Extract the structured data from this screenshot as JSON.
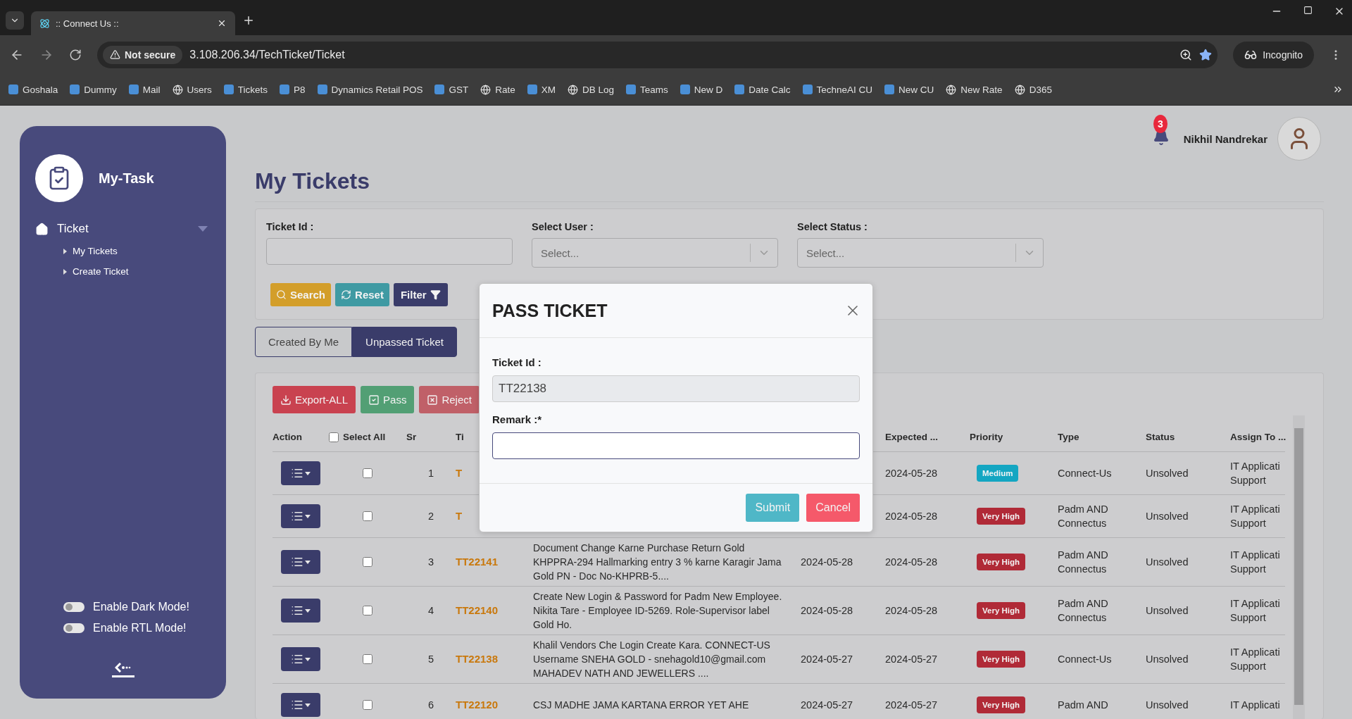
{
  "browser": {
    "tab_title": ":: Connect Us ::",
    "security": "Not secure",
    "url": "3.108.206.34/TechTicket/Ticket",
    "profile": "Incognito",
    "bookmarks": [
      {
        "label": "Goshala",
        "kind": "favicon"
      },
      {
        "label": "Dummy",
        "kind": "favicon"
      },
      {
        "label": "Mail",
        "kind": "favicon"
      },
      {
        "label": "Users",
        "kind": "globe"
      },
      {
        "label": "Tickets",
        "kind": "favicon"
      },
      {
        "label": "P8",
        "kind": "favicon"
      },
      {
        "label": "Dynamics Retail POS",
        "kind": "favicon"
      },
      {
        "label": "GST",
        "kind": "favicon"
      },
      {
        "label": "Rate",
        "kind": "globe"
      },
      {
        "label": "XM",
        "kind": "favicon"
      },
      {
        "label": "DB Log",
        "kind": "globe"
      },
      {
        "label": "Teams",
        "kind": "favicon"
      },
      {
        "label": "New D",
        "kind": "favicon"
      },
      {
        "label": "Date Calc",
        "kind": "favicon"
      },
      {
        "label": "TechneAI CU",
        "kind": "favicon"
      },
      {
        "label": "New CU",
        "kind": "favicon"
      },
      {
        "label": "New Rate",
        "kind": "globe"
      },
      {
        "label": "D365",
        "kind": "globe"
      }
    ]
  },
  "sidebar": {
    "app_name": "My-Task",
    "menu": [
      {
        "label": "Ticket",
        "expanded": true,
        "children": [
          {
            "label": "My Tickets"
          },
          {
            "label": "Create Ticket"
          }
        ]
      }
    ],
    "toggles": [
      {
        "label": "Enable Dark Mode!",
        "on": false
      },
      {
        "label": "Enable RTL Mode!",
        "on": false
      }
    ]
  },
  "header": {
    "notification_count": "3",
    "user_name": "Nikhil Nandrekar"
  },
  "page_title": "My Tickets",
  "filters": [
    {
      "label": "Ticket Id :",
      "kind": "text"
    },
    {
      "label": "Select User :",
      "kind": "select",
      "placeholder": "Select..."
    },
    {
      "label": "Select Status :",
      "kind": "select",
      "placeholder": "Select..."
    }
  ],
  "filter_buttons": [
    {
      "label": "Search",
      "kind": "search"
    },
    {
      "label": "Reset",
      "kind": "reset"
    },
    {
      "label": "Filter",
      "kind": "filter"
    }
  ],
  "tabs": [
    {
      "label": "Created By Me",
      "selected": false
    },
    {
      "label": "Unpassed Ticket",
      "selected": true
    }
  ],
  "actions": [
    {
      "label": "Export-ALL",
      "kind": "export"
    },
    {
      "label": "Pass",
      "kind": "pass"
    },
    {
      "label": "Reject",
      "kind": "reject"
    }
  ],
  "table": {
    "select_all": {
      "label": "Select All",
      "checked": false
    },
    "columns": {
      "action": "Action",
      "sr": "Sr",
      "ticket_id": "Ti",
      "expected": "Expected ...",
      "priority": "Priority",
      "type": "Type",
      "status": "Status",
      "assign_to": "Assign To ..."
    },
    "rows": [
      {
        "checked": false,
        "sr": "1",
        "ticket_id": "T",
        "expected": "2024-05-28",
        "priority": {
          "label": "Medium",
          "color": "#14a6c2"
        },
        "type": "Connect-Us",
        "status": "Unsolved",
        "assign_to": "IT Applicati Support"
      },
      {
        "checked": false,
        "sr": "2",
        "ticket_id": "T",
        "expected": "2024-05-28",
        "priority": {
          "label": "Very High",
          "color": "#b02a37"
        },
        "type": "Padm AND Connectus",
        "status": "Unsolved",
        "assign_to": "IT Applicati Support"
      },
      {
        "checked": false,
        "sr": "3",
        "ticket_id": "TT22141",
        "description": "Document Change Karne Purchase Return Gold KHPPRA-294 Hallmarking entry 3 % karne Karagir Jama Gold PN - Doc No-KHPRB-5....",
        "created": "2024-05-28",
        "expected": "2024-05-28",
        "priority": {
          "label": "Very High",
          "color": "#b02a37"
        },
        "type": "Padm AND Connectus",
        "status": "Unsolved",
        "assign_to": "IT Applicati Support"
      },
      {
        "checked": false,
        "sr": "4",
        "ticket_id": "TT22140",
        "description": "Create New Login & Password for Padm New Employee. Nikita Tare - Employee ID-5269. Role-Supervisor label Gold Ho.",
        "created": "2024-05-28",
        "expected": "2024-05-28",
        "priority": {
          "label": "Very High",
          "color": "#b02a37"
        },
        "type": "Padm AND Connectus",
        "status": "Unsolved",
        "assign_to": "IT Applicati Support"
      },
      {
        "checked": false,
        "sr": "5",
        "ticket_id": "TT22138",
        "description": "Khalil Vendors Che Login Create Kara. CONNECT-US Username SNEHA GOLD - snehagold10@gmail.com MAHADEV NATH AND JEWELLERS ....",
        "created": "2024-05-27",
        "expected": "2024-05-27",
        "priority": {
          "label": "Very High",
          "color": "#b02a37"
        },
        "type": "Connect-Us",
        "status": "Unsolved",
        "assign_to": "IT Applicati Support"
      },
      {
        "checked": false,
        "sr": "6",
        "ticket_id": "TT22120",
        "description": "CSJ MADHE JAMA KARTANA ERROR YET AHE",
        "created": "2024-05-27",
        "expected": "2024-05-27",
        "priority": {
          "label": "Very High",
          "color": "#b02a37"
        },
        "type": "Padm AND",
        "status": "Unsolved",
        "assign_to": "IT Applicati"
      }
    ]
  },
  "modal": {
    "title": "PASS TICKET",
    "fields": [
      {
        "label": "Ticket Id :",
        "value": "TT22138",
        "disabled": true
      },
      {
        "label": "Remark :*",
        "disabled": false
      }
    ],
    "buttons": [
      {
        "label": "Submit",
        "kind": "submit"
      },
      {
        "label": "Cancel",
        "kind": "cancel"
      }
    ]
  }
}
